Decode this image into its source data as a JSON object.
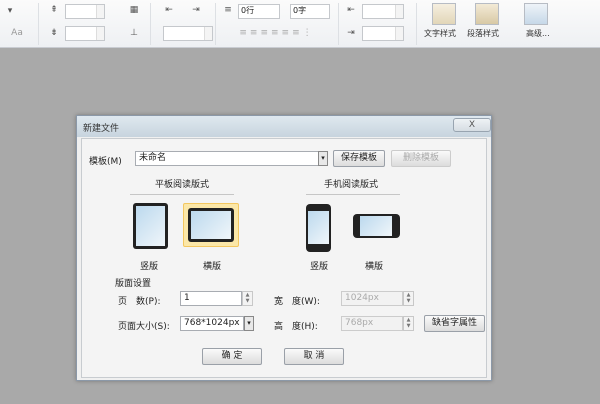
{
  "ribbon": {
    "aa_label": "Aa",
    "line_spacing": "0行",
    "char_spacing": "0字",
    "text_style": "文字样式",
    "para_style": "段落样式",
    "advanced": "高级..."
  },
  "dialog": {
    "title": "新建文件",
    "close": "X",
    "template_label": "模板(M)",
    "template_value": "未命名",
    "save_template": "保存模板",
    "delete_template": "删除模板",
    "tablet_header": "平板阅读版式",
    "phone_header": "手机阅读版式",
    "portrait": "竖版",
    "landscape": "横版",
    "layout_section": "版面设置",
    "pages_label": "页　数(P):",
    "pages_value": "1",
    "size_label": "页面大小(S):",
    "size_value": "768*1024px",
    "width_label": "宽　度(W):",
    "width_value": "1024px",
    "height_label": "高　度(H):",
    "height_value": "768px",
    "default_font": "缺省字属性",
    "ok": "确 定",
    "cancel": "取 消"
  },
  "colors": {
    "selected_border": "#f3c760",
    "titlebar": "#c7d4de",
    "workspace": "#a9a9a9"
  }
}
